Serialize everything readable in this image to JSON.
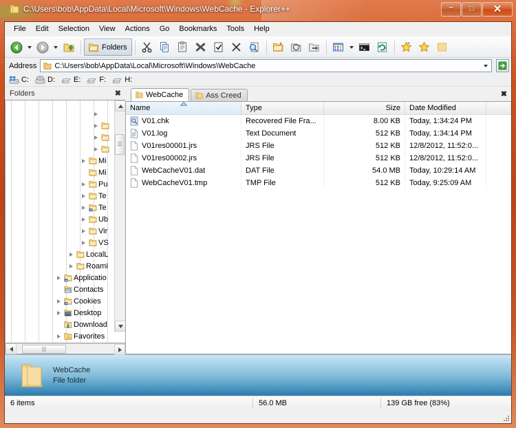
{
  "window": {
    "title": "C:\\Users\\bob\\AppData\\Local\\Microsoft\\Windows\\WebCache - Explorer++",
    "title_icon": "folder-icon",
    "minimize_label": "–",
    "maximize_label": "□",
    "close_label": "✕",
    "accent_color": "#c4501f"
  },
  "menubar": {
    "items": [
      {
        "label": "File"
      },
      {
        "label": "Edit"
      },
      {
        "label": "Selection"
      },
      {
        "label": "View"
      },
      {
        "label": "Actions"
      },
      {
        "label": "Go"
      },
      {
        "label": "Bookmarks"
      },
      {
        "label": "Tools"
      },
      {
        "label": "Help"
      }
    ]
  },
  "toolbar": {
    "back": "back-icon",
    "forward": "forward-icon",
    "up": "up-one-level-icon",
    "folders_label": "Folders",
    "cut": "scissors-icon",
    "copy": "copy-icon",
    "paste": "paste-icon",
    "delete": "delete-icon",
    "select_all": "select-all-icon",
    "delete_permanently": "delete-permanently-icon",
    "search": "search-icon",
    "new_folder": "new-folder-icon",
    "copy_to": "copy-to-folder-icon",
    "move_to": "move-to-folder-icon",
    "views": "views-icon",
    "open_command_prompt": "command-prompt-icon",
    "refresh": "refresh-icon",
    "add_bookmark": "add-bookmark-star-icon",
    "organize_bookmarks": "bookmarks-star-icon",
    "folder": "folder-icon"
  },
  "address": {
    "label": "Address",
    "value": "C:\\Users\\bob\\AppData\\Local\\Microsoft\\Windows\\WebCache",
    "placeholder": "",
    "go_label": "→"
  },
  "drives": [
    {
      "label": "C:",
      "icon": "windows-drive-icon"
    },
    {
      "label": "D:",
      "icon": "optical-drive-icon"
    },
    {
      "label": "E:",
      "icon": "removable-drive-icon"
    },
    {
      "label": "F:",
      "icon": "removable-drive-icon"
    },
    {
      "label": "H:",
      "icon": "removable-drive-icon"
    }
  ],
  "folders_pane": {
    "title": "Folders",
    "close_label": "✖",
    "nodes": [
      {
        "label": "",
        "indent": 10,
        "expander": false,
        "icon": "none",
        "partial": true
      },
      {
        "label": "",
        "indent": 9,
        "expander": true,
        "icon": "none"
      },
      {
        "label": "",
        "indent": 9,
        "expander": true,
        "icon": "folder"
      },
      {
        "label": "",
        "indent": 9,
        "expander": true,
        "icon": "folder"
      },
      {
        "label": "",
        "indent": 9,
        "expander": true,
        "icon": "folder"
      },
      {
        "label": "Mi",
        "indent": 8,
        "expander": true,
        "icon": "folder"
      },
      {
        "label": "Mi",
        "indent": 8,
        "expander": false,
        "icon": "folder"
      },
      {
        "label": "Pu",
        "indent": 8,
        "expander": true,
        "icon": "folder"
      },
      {
        "label": "Te",
        "indent": 8,
        "expander": true,
        "icon": "folder"
      },
      {
        "label": "Te",
        "indent": 8,
        "expander": true,
        "icon": "folder-shortcut"
      },
      {
        "label": "Ub",
        "indent": 8,
        "expander": true,
        "icon": "folder"
      },
      {
        "label": "Vir",
        "indent": 8,
        "expander": true,
        "icon": "folder"
      },
      {
        "label": "VS",
        "indent": 8,
        "expander": true,
        "icon": "folder"
      },
      {
        "label": "LocalL",
        "indent": 7,
        "expander": true,
        "icon": "folder"
      },
      {
        "label": "Roami",
        "indent": 7,
        "expander": true,
        "icon": "folder"
      },
      {
        "label": "Applicatio",
        "indent": 6,
        "expander": true,
        "icon": "folder-shortcut"
      },
      {
        "label": "Contacts",
        "indent": 6,
        "expander": false,
        "icon": "contacts-folder"
      },
      {
        "label": "Cookies",
        "indent": 6,
        "expander": true,
        "icon": "folder-shortcut"
      },
      {
        "label": "Desktop",
        "indent": 6,
        "expander": true,
        "icon": "desktop-folder"
      },
      {
        "label": "Download",
        "indent": 6,
        "expander": false,
        "icon": "downloads-folder"
      },
      {
        "label": "Favorites",
        "indent": 6,
        "expander": true,
        "icon": "favorites-folder"
      },
      {
        "label": "",
        "indent": 6,
        "expander": false,
        "icon": "folder",
        "partial": true
      }
    ]
  },
  "tabs": [
    {
      "label": "WebCache",
      "active": true,
      "icon": "folder-icon"
    },
    {
      "label": "Ass Creed",
      "active": false,
      "icon": "folder-icon"
    }
  ],
  "tabbar": {
    "close_label": "✖"
  },
  "filelist": {
    "columns": [
      {
        "label": "Name",
        "width": 168,
        "align": "left",
        "sorted": true,
        "sort_dir": "asc"
      },
      {
        "label": "Type",
        "width": 120,
        "align": "left",
        "sorted": false
      },
      {
        "label": "Size",
        "width": 118,
        "align": "right",
        "sorted": false
      },
      {
        "label": "Date Modified",
        "width": 118,
        "align": "left",
        "sorted": false
      },
      {
        "label": "",
        "width": 36,
        "align": "left",
        "sorted": false
      }
    ],
    "rows": [
      {
        "name": "V01.chk",
        "type": "Recovered File Fra...",
        "size": "8.00 KB",
        "date": "Today, 1:34:24 PM",
        "icon": "recovered-file-icon"
      },
      {
        "name": "V01.log",
        "type": "Text Document",
        "size": "512 KB",
        "date": "Today, 1:34:14 PM",
        "icon": "text-document-icon"
      },
      {
        "name": "V01res00001.jrs",
        "type": "JRS File",
        "size": "512 KB",
        "date": "12/8/2012, 11:52:0...",
        "icon": "generic-file-icon"
      },
      {
        "name": "V01res00002.jrs",
        "type": "JRS File",
        "size": "512 KB",
        "date": "12/8/2012, 11:52:0...",
        "icon": "generic-file-icon"
      },
      {
        "name": "WebCacheV01.dat",
        "type": "DAT File",
        "size": "54.0 MB",
        "date": "Today, 10:29:14 AM",
        "icon": "generic-file-icon"
      },
      {
        "name": "WebCacheV01.tmp",
        "type": "TMP File",
        "size": "512 KB",
        "date": "Today, 9:25:09 AM",
        "icon": "generic-file-icon"
      }
    ]
  },
  "info_panel": {
    "name": "WebCache",
    "subtitle": "File folder",
    "icon": "large-folder-icon"
  },
  "statusbar": {
    "items_text": "6 items",
    "size_text": "56.0 MB",
    "free_text": "139 GB free (83%)"
  }
}
